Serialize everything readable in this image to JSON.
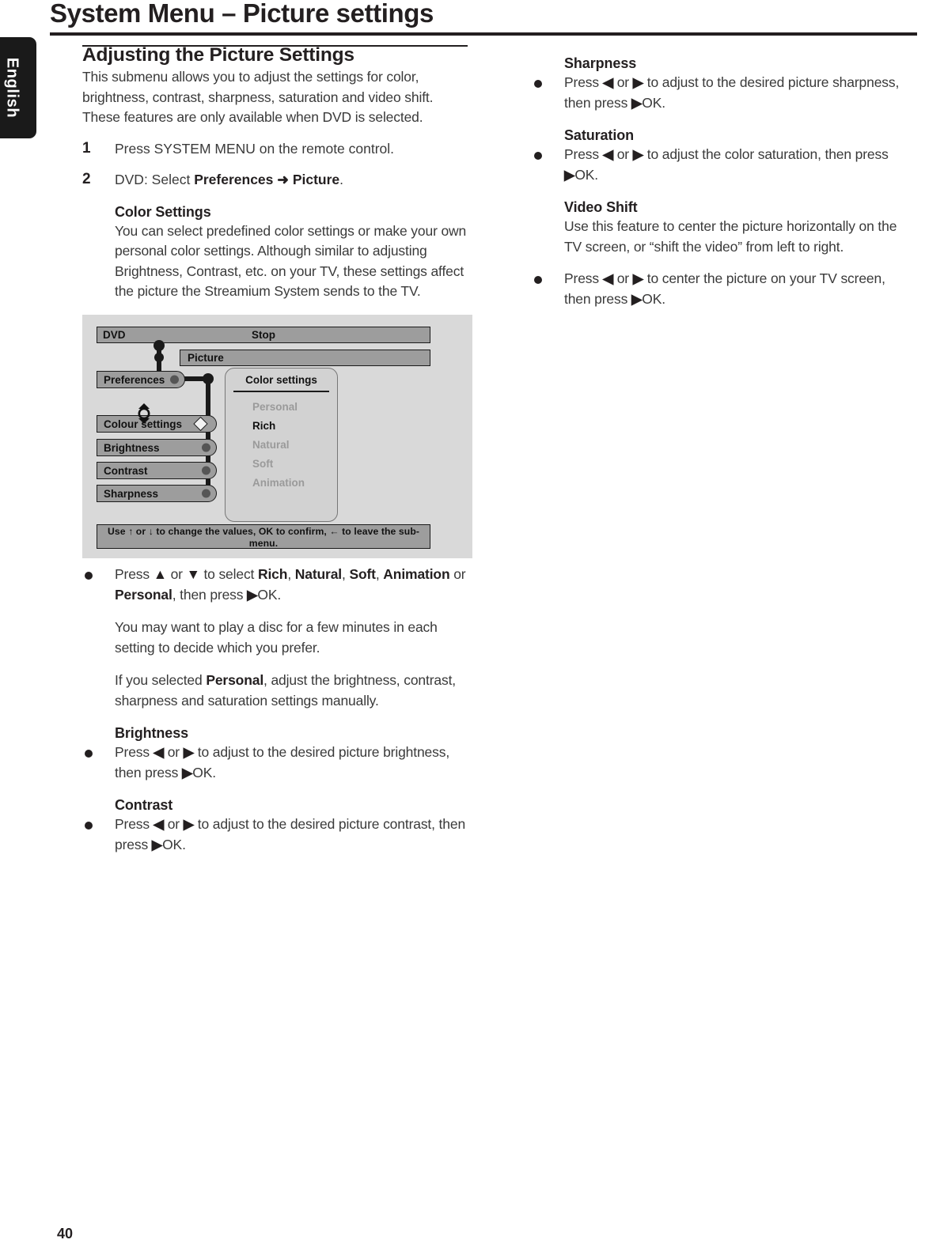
{
  "page": {
    "title": "System Menu – Picture settings",
    "language_tab": "English",
    "number": "40"
  },
  "left_column": {
    "heading": "Adjusting the Picture Settings",
    "intro": "This submenu allows you to adjust the settings for color, brightness, contrast, sharpness, saturation and video shift. These features are only available when DVD is selected.",
    "steps": [
      {
        "num": "1",
        "text": "Press SYSTEM MENU on the remote control."
      },
      {
        "num": "2",
        "text_before": "DVD: Select ",
        "bold1": "Preferences",
        "arrow": "➜",
        "bold2": "Picture",
        "text_after": "."
      }
    ],
    "color_settings": {
      "heading": "Color Settings",
      "body": "You can select predefined color settings or make your own personal color settings. Although similar to adjusting Brightness, Contrast, etc. on your TV, these settings affect the picture the Streamium System sends to the TV."
    },
    "after_diagram": {
      "bullet1": {
        "a": "Press ",
        "up": "▲",
        "b": " or ",
        "down": "▼",
        "c": " to select ",
        "opt1": "Rich",
        "opt2": "Natural",
        "opt3": "Soft",
        "opt4": "Animation",
        "d": " or ",
        "opt5": "Personal",
        "e": ", then press ",
        "play": "▶",
        "f": "OK."
      },
      "note1": "You may want to play a disc for a few minutes in each setting to decide which you prefer.",
      "note2_a": "If you selected ",
      "note2_bold": "Personal",
      "note2_b": ", adjust the brightness, contrast, sharpness and saturation settings manually."
    },
    "brightness": {
      "heading": "Brightness",
      "a": "Press ",
      "left": "◀",
      "b": " or ",
      "right": "▶",
      "c": " to adjust to the desired picture brightness, then press ",
      "play": "▶",
      "d": "OK."
    },
    "contrast": {
      "heading": "Contrast",
      "a": "Press ",
      "left": "◀",
      "b": " or ",
      "right": "▶",
      "c": " to adjust to the desired picture contrast, then press ",
      "play": "▶",
      "d": "OK."
    }
  },
  "right_column": {
    "sharpness": {
      "heading": "Sharpness",
      "a": "Press ",
      "left": "◀",
      "b": " or ",
      "right": "▶",
      "c": " to adjust to the desired picture sharpness, then press ",
      "play": "▶",
      "d": "OK."
    },
    "saturation": {
      "heading": "Saturation",
      "a": "Press ",
      "left": "◀",
      "b": " or ",
      "right": "▶",
      "c": " to adjust the color saturation, then press ",
      "play": "▶",
      "d": "OK."
    },
    "video_shift": {
      "heading": "Video Shift",
      "body": "Use this feature to center the picture horizontally on the TV screen, or “shift the video” from left to right.",
      "a": "Press ",
      "left": "◀",
      "b": " or ",
      "right": "▶",
      "c": " to center the picture on your TV screen, then press ",
      "play": "▶",
      "d": "OK."
    }
  },
  "diagram": {
    "status_bar": {
      "source": "DVD",
      "state": "Stop"
    },
    "picture_bar": "Picture",
    "menu_items": [
      {
        "label": "Preferences",
        "indicator": "dot"
      },
      {
        "label": "Colour settings",
        "indicator": "diamond"
      },
      {
        "label": "Brightness",
        "indicator": "dot"
      },
      {
        "label": "Contrast",
        "indicator": "dot"
      },
      {
        "label": "Sharpness",
        "indicator": "dot"
      }
    ],
    "submenu": {
      "title": "Color settings",
      "options": [
        "Personal",
        "Rich",
        "Natural",
        "Soft",
        "Animation"
      ],
      "selected": "Rich"
    },
    "hint": "Use ↑ or ↓ to change the values, OK to confirm, ← to leave the sub-menu.",
    "colors": {
      "panel_bg": "#d9d9d9",
      "bar_fill": "#9d9d9d",
      "submenu_bg": "#d2d2d2",
      "outline": "#1a1a1a",
      "dim_text": "#9a9a9a"
    }
  }
}
